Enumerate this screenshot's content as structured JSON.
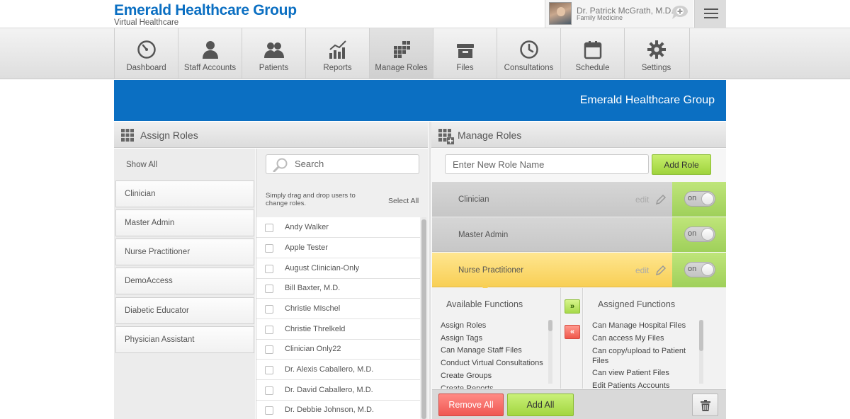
{
  "header": {
    "brand_title": "Emerald Healthcare Group",
    "brand_subtitle": "Virtual Healthcare",
    "user_name": "Dr. Patrick McGrath, M.D.",
    "user_specialty": "Family Medicine",
    "chat_icon": "chat-plus-icon",
    "menu_icon": "hamburger-icon"
  },
  "nav": {
    "items": [
      {
        "label": "Dashboard",
        "icon": "gauge-icon"
      },
      {
        "label": "Staff Accounts",
        "icon": "person-icon"
      },
      {
        "label": "Patients",
        "icon": "people-icon"
      },
      {
        "label": "Reports",
        "icon": "chart-icon"
      },
      {
        "label": "Manage Roles",
        "icon": "grid-icon",
        "active": true
      },
      {
        "label": "Files",
        "icon": "archive-box-icon"
      },
      {
        "label": "Consultations",
        "icon": "clock-icon"
      },
      {
        "label": "Schedule",
        "icon": "calendar-icon"
      },
      {
        "label": "Settings",
        "icon": "gear-icon"
      }
    ]
  },
  "banner": {
    "title": "Emerald Healthcare Group",
    "color": "#0b6fc2"
  },
  "assign_roles": {
    "title": "Assign Roles",
    "show_all": "Show All",
    "roles": [
      "Clinician",
      "Master Admin",
      "Nurse Practitioner",
      "DemoAccess",
      "Diabetic Educator",
      "Physician Assistant"
    ],
    "search_placeholder": "Search",
    "hint": "Simply drag and drop users to change roles.",
    "select_all": "Select All",
    "users": [
      "Andy Walker",
      "Apple Tester",
      "August Clinician-Only",
      "Bill Baxter, M.D.",
      "Christie MIschel",
      "Christie Threlkeld",
      "Clinician Only22",
      "Dr. Alexis Caballero, M.D.",
      "Dr. David Caballero, M.D.",
      "Dr. Debbie Johnson, M.D."
    ]
  },
  "manage_roles": {
    "title": "Manage Roles",
    "new_role_placeholder": "Enter New Role Name",
    "add_role": "Add Role",
    "roles": [
      {
        "name": "Clinician",
        "edit": "edit",
        "toggle": "on",
        "selected": false
      },
      {
        "name": "Master Admin",
        "edit": "",
        "toggle": "on",
        "selected": false
      },
      {
        "name": "Nurse Practitioner",
        "edit": "edit",
        "toggle": "on",
        "selected": true
      }
    ],
    "available_title": "Available Functions",
    "available": [
      "Assign Roles",
      "Assign Tags",
      "Can Manage Staff Files",
      "Conduct Virtual Consultations",
      "Create Groups",
      "Create Reports"
    ],
    "assigned_title": "Assigned Functions",
    "assigned": [
      "Can Manage Hospital Files",
      "Can access My Files",
      "Can copy/upload to Patient Files",
      "Can view Patient Files",
      "Edit Patients Accounts"
    ],
    "move_add": "»",
    "move_remove": "«",
    "remove_all": "Remove All",
    "add_all": "Add All",
    "trash_icon": "trash-icon",
    "accent_green": "#9fd33c",
    "accent_red": "#ef5753",
    "selected_yellow": "#f8cf55"
  }
}
